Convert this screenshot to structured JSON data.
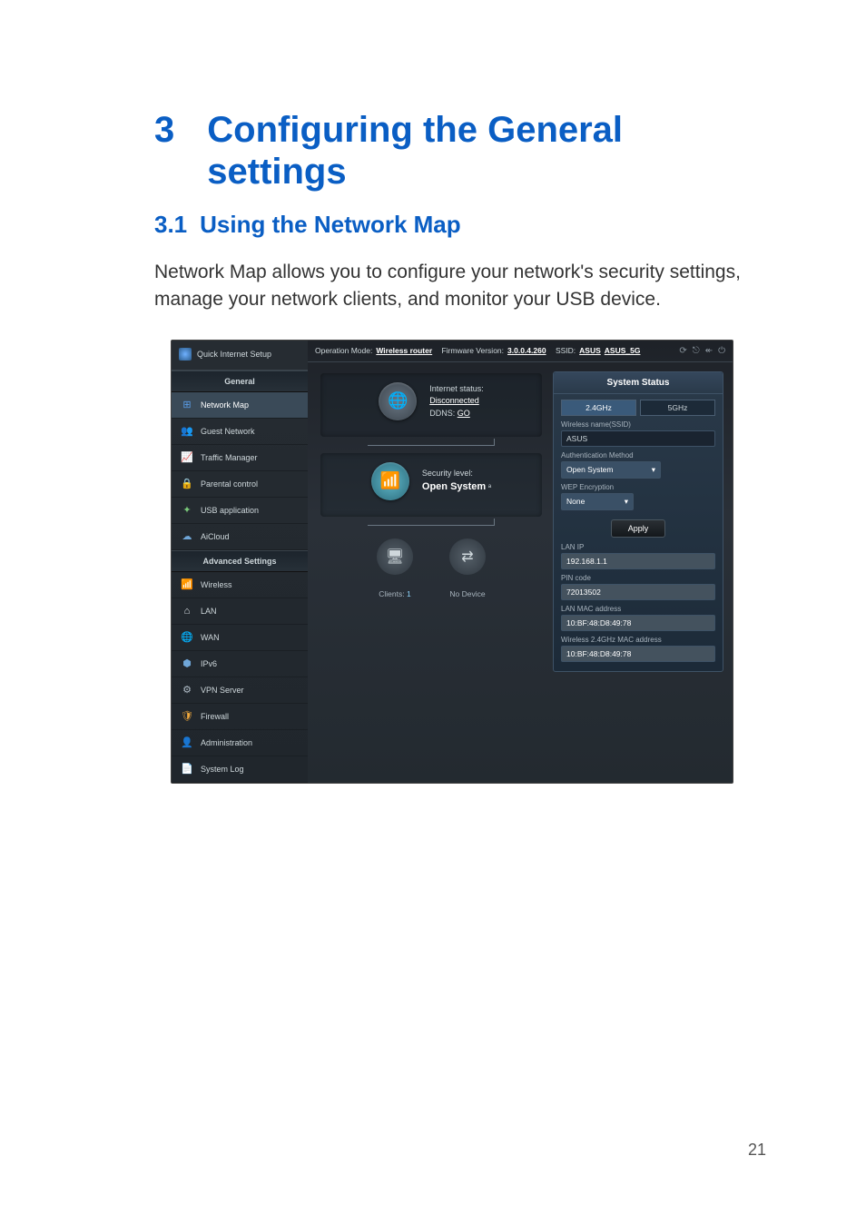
{
  "chapter": {
    "number": "3",
    "title": "Configuring the General settings"
  },
  "section": {
    "number": "3.1",
    "title": "Using the Network Map"
  },
  "body_paragraph": "Network Map allows you to configure your network's security settings, manage your network clients, and monitor your USB device.",
  "page_number": "21",
  "router_ui": {
    "qis": "Quick Internet Setup",
    "nav_general_header": "General",
    "nav_general": [
      {
        "label": "Network Map",
        "icon_class": "ni-map",
        "glyph": "⊞",
        "active": true
      },
      {
        "label": "Guest Network",
        "icon_class": "ni-guest",
        "glyph": "👥"
      },
      {
        "label": "Traffic Manager",
        "icon_class": "ni-traffic",
        "glyph": "📈"
      },
      {
        "label": "Parental control",
        "icon_class": "ni-parent",
        "glyph": "🔒"
      },
      {
        "label": "USB application",
        "icon_class": "ni-usb",
        "glyph": "✦"
      },
      {
        "label": "AiCloud",
        "icon_class": "ni-cloud",
        "glyph": "☁"
      }
    ],
    "nav_advanced_header": "Advanced Settings",
    "nav_advanced": [
      {
        "label": "Wireless",
        "icon_class": "ni-wireless",
        "glyph": "📶"
      },
      {
        "label": "LAN",
        "icon_class": "ni-lan",
        "glyph": "⌂"
      },
      {
        "label": "WAN",
        "icon_class": "ni-wan",
        "glyph": "🌐"
      },
      {
        "label": "IPv6",
        "icon_class": "ni-ipv6",
        "glyph": "⬢"
      },
      {
        "label": "VPN Server",
        "icon_class": "ni-vpn",
        "glyph": "⚙"
      },
      {
        "label": "Firewall",
        "icon_class": "ni-firewall",
        "glyph": "🛡"
      },
      {
        "label": "Administration",
        "icon_class": "ni-admin",
        "glyph": "👤"
      },
      {
        "label": "System Log",
        "icon_class": "ni-log",
        "glyph": "📄"
      }
    ],
    "topbar": {
      "op_mode_label": "Operation Mode:",
      "op_mode_value": "Wireless router",
      "fw_label": "Firmware Version:",
      "fw_value": "3.0.0.4.260",
      "ssid_label": "SSID:",
      "ssid_value_1": "ASUS",
      "ssid_value_2": "ASUS_5G"
    },
    "center": {
      "internet_status_label": "Internet status:",
      "internet_status_value": "Disconnected",
      "ddns_label": "DDNS:",
      "ddns_value": "GO",
      "security_label": "Security level:",
      "security_value": "Open System",
      "security_suffix": "ᵃ",
      "clients_label": "Clients:",
      "clients_count": "1",
      "no_device": "No Device"
    },
    "right": {
      "title": "System Status",
      "tab_24": "2.4GHz",
      "tab_5": "5GHz",
      "fields": {
        "ssid_label": "Wireless name(SSID)",
        "ssid_value": "ASUS",
        "auth_label": "Authentication Method",
        "auth_value": "Open System",
        "wep_label": "WEP Encryption",
        "wep_value": "None",
        "apply": "Apply",
        "lan_ip_label": "LAN IP",
        "lan_ip_value": "192.168.1.1",
        "pin_label": "PIN code",
        "pin_value": "72013502",
        "lan_mac_label": "LAN MAC address",
        "lan_mac_value": "10:BF:48:D8:49:78",
        "wl_mac_label": "Wireless 2.4GHz MAC address",
        "wl_mac_value": "10:BF:48:D8:49:78"
      }
    }
  }
}
